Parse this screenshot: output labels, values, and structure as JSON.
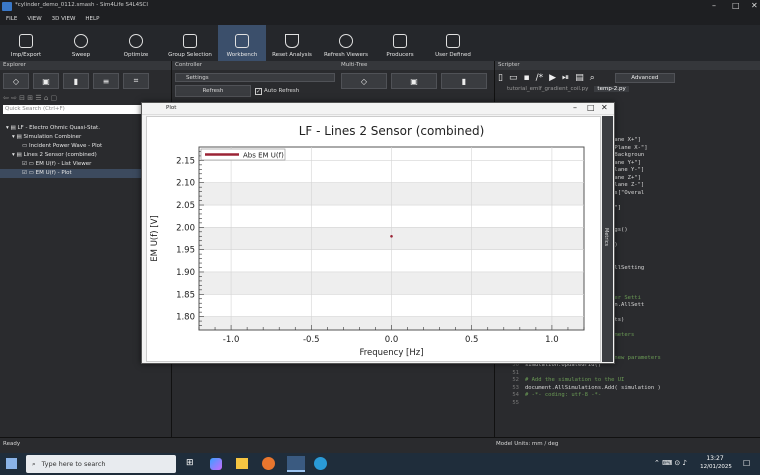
{
  "window": {
    "title": "*cylinder_demo_0112.smash - Sim4Life S4L4SCI",
    "controls": [
      "–",
      "□",
      "✕"
    ]
  },
  "menu": [
    "FILE",
    "VIEW",
    "3D VIEW",
    "HELP"
  ],
  "ribbon": [
    {
      "label": "Imp/Export",
      "icon": "import-export-icon",
      "dropdown": true
    },
    {
      "label": "Sweep",
      "icon": "sweep-icon"
    },
    {
      "label": "Optimize",
      "icon": "optimize-icon"
    },
    {
      "label": "Group Selection",
      "icon": "group-selection-icon"
    },
    {
      "label": "Workbench",
      "icon": "workbench-icon",
      "active": true
    },
    {
      "label": "Reset Analysis",
      "icon": "reset-analysis-icon"
    },
    {
      "label": "Refresh Viewers",
      "icon": "refresh-viewers-icon"
    },
    {
      "label": "Producers",
      "icon": "producers-icon",
      "dropdown": true
    },
    {
      "label": "User Defined",
      "icon": "user-defined-icon",
      "dropdown": true
    }
  ],
  "explorer": {
    "title": "Explorer",
    "search_placeholder": "Quick Search (Ctrl+F)",
    "tree": [
      {
        "label": "LF - Electro Ohmic Quasi-Stat.",
        "level": 0
      },
      {
        "label": "Simulation Combiner",
        "level": 1
      },
      {
        "label": "Incident Power Wave - Plot",
        "level": 2
      },
      {
        "label": "Lines 2 Sensor (combined)",
        "level": 1
      },
      {
        "label": "EM U(f) - List Viewer",
        "level": 2
      },
      {
        "label": "EM U(f) - Plot",
        "level": 2,
        "selected": true
      }
    ]
  },
  "controller": {
    "title": "Controller",
    "settings": "Settings",
    "refresh": "Refresh",
    "auto_refresh": "Auto Refresh"
  },
  "multitree": {
    "title": "Multi-Tree"
  },
  "scripter": {
    "title": "Scripter",
    "mode": "Advanced",
    "tabs": [
      "tutorial_emlf_gradient_coil.py",
      "temp-2.py"
    ],
    "code_lines": [
      {
        "n": "",
        "t": "on",
        "c": "cs"
      },
      {
        "n": "",
        "t": "roQsOhmicSimulation()",
        "c": "ct"
      },
      {
        "n": "",
        "t": "",
        "c": "ct"
      },
      {
        "n": "",
        "t": " and entities",
        "c": "cm"
      },
      {
        "n": "",
        "t": "imulation.AllComponents[\"Plane X+\"]",
        "c": "ct"
      },
      {
        "n": "",
        "t": " simulation.AllComponents[\"Plane X-\"]",
        "c": "ct"
      },
      {
        "n": "",
        "t": " simulation.AllComponents[\"Backgroun",
        "c": "ct"
      },
      {
        "n": "",
        "t": "imulation.AllComponents[\"Plane Y+\"]",
        "c": "ct"
      },
      {
        "n": "",
        "t": "simulation.AllComponents[\"Plane Y-\"]",
        "c": "ct"
      },
      {
        "n": "",
        "t": "imulation.AllComponents[\"Plane Z+\"]",
        "c": "ct"
      },
      {
        "n": "",
        "t": "simulation.AllComponents[\"Plane Z-\"]",
        "c": "ct"
      },
      {
        "n": "",
        "t": "l = simulation.AllComponents[\"Overal",
        "c": "ct"
      },
      {
        "n": "",
        "t": "",
        "c": "ct"
      },
      {
        "n": "",
        "t": "lEntities()[\"Lines 2 Sensor\"]",
        "c": "ct"
      },
      {
        "n": "",
        "t": "",
        "c": "ct"
      },
      {
        "n": "",
        "t": "ensorSettings",
        "c": "cm"
      },
      {
        "n": "",
        "t": " = emlf.VoltageSensorSettings()",
        "c": "ct"
      },
      {
        "n": "",
        "t": "line)",
        "c": "ct"
      },
      {
        "n": "",
        "t": "sensor_settings, components)",
        "c": "ct"
      },
      {
        "n": "",
        "t": "",
        "c": "ct"
      },
      {
        "n": "",
        "t": "Settings \"Automatic",
        "c": "cm"
      },
      {
        "n": "",
        "t": " = [x for x in simulation.AllSetting",
        "c": "ct"
      },
      {
        "n": "",
        "t": "line]",
        "c": "ct"
      },
      {
        "n": "",
        "t": "_grid_settings, components)",
        "c": "ct"
      },
      {
        "n": "",
        "t": "",
        "c": "ct"
      },
      {
        "n": "",
        "t": "elSettings \"Automatic Voxeler Setti",
        "c": "cm"
      },
      {
        "n": "",
        "t": "ngs = [x for x in simulation.AllSett",
        "c": "ct"
      },
      {
        "n": "",
        "t": "line]",
        "c": "ct"
      },
      {
        "n": "",
        "t": "_voxeler_settings, components)",
        "c": "ct"
      },
      {
        "n": "",
        "t": "",
        "c": "ct"
      },
      {
        "n": "",
        "t": "with the new frequency parameters",
        "c": "cm"
      },
      {
        "n": "",
        "t": "rials()",
        "c": "ct"
      },
      {
        "n": "48",
        "t": "",
        "c": "ct"
      },
      {
        "n": "49",
        "t": "# Update the grid with the new parameters",
        "c": "cm"
      },
      {
        "n": "50",
        "t": "simulation.UpdateGrid()",
        "c": "ct"
      },
      {
        "n": "51",
        "t": "",
        "c": "ct"
      },
      {
        "n": "52",
        "t": "# Add the simulation to the UI",
        "c": "cm"
      },
      {
        "n": "53",
        "t": "document.AllSimulations.Add( simulation )",
        "c": "ct"
      },
      {
        "n": "54",
        "t": "# -*- coding: utf-8 -*-",
        "c": "cm"
      },
      {
        "n": "55",
        "t": "",
        "c": "ct"
      }
    ]
  },
  "plot_window": {
    "title": "Plot",
    "controls": [
      "–",
      "□",
      "✕"
    ],
    "side_tab": "Metrics"
  },
  "chart_data": {
    "type": "scatter",
    "title": "LF - Lines 2 Sensor (combined)",
    "xlabel": "Frequency [Hz]",
    "ylabel": "EM U(f) [V]",
    "xlim": [
      -1.2,
      1.2
    ],
    "ylim": [
      1.77,
      2.18
    ],
    "xticks": [
      -1.0,
      -0.5,
      0.0,
      0.5,
      1.0
    ],
    "xtick_labels": [
      "-1.0",
      "-0.5",
      "0.0",
      "0.5",
      "1.0"
    ],
    "yticks": [
      1.8,
      1.85,
      1.9,
      1.95,
      2.0,
      2.05,
      2.1,
      2.15
    ],
    "ytick_labels": [
      "1.80",
      "1.85",
      "1.90",
      "1.95",
      "2.00",
      "2.05",
      "2.10",
      "2.15"
    ],
    "series": [
      {
        "name": "Abs EM U(f)",
        "color": "#9b2335",
        "x": [
          0.0
        ],
        "y": [
          1.98
        ]
      }
    ],
    "legend": "top-left",
    "grid": true
  },
  "status": {
    "left": "Ready",
    "right": "Model Units: mm / deg"
  },
  "taskbar": {
    "search_placeholder": "Type here to search",
    "time": "13:27",
    "date": "12/01/2025"
  }
}
